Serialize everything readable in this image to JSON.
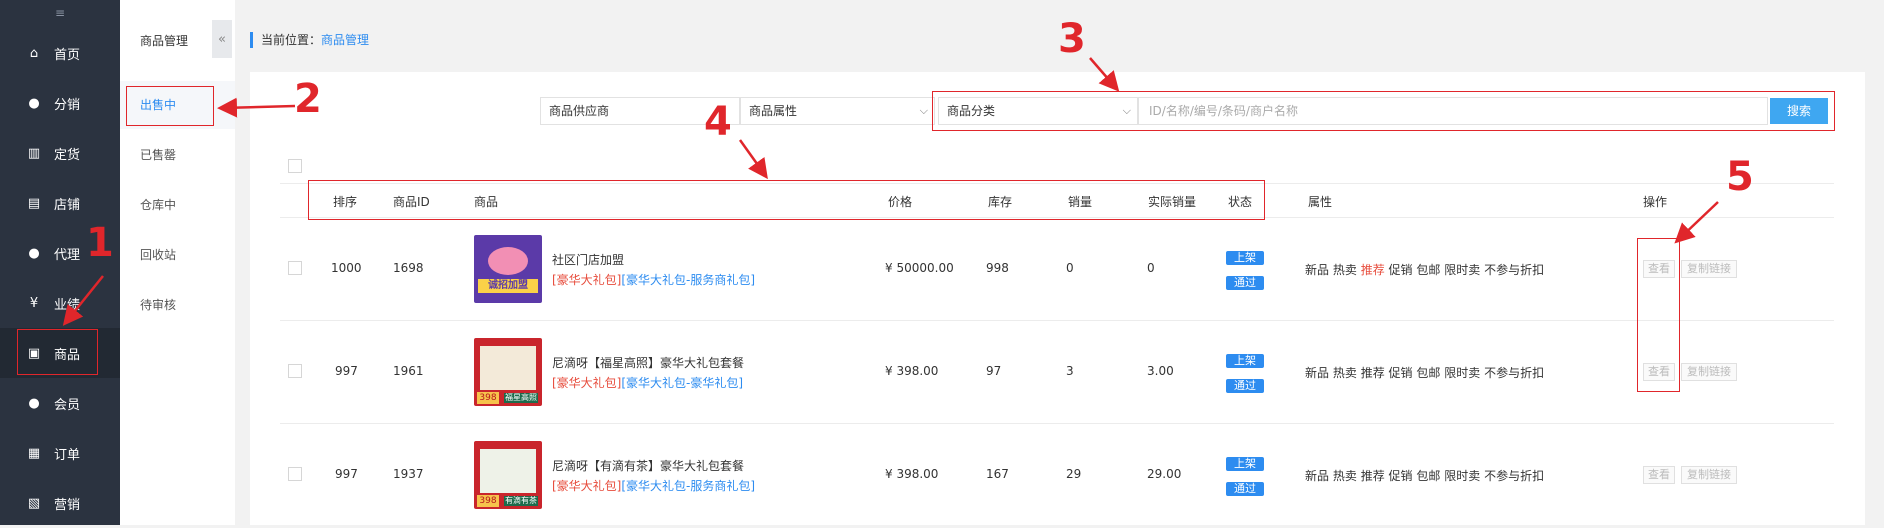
{
  "sidebar": {
    "items": [
      {
        "label": "首页",
        "icon": "home-icon",
        "glyph": "⌂"
      },
      {
        "label": "分销",
        "icon": "user-icon",
        "glyph": "●"
      },
      {
        "label": "定货",
        "icon": "bar-chart-icon",
        "glyph": "▥"
      },
      {
        "label": "店铺",
        "icon": "store-icon",
        "glyph": "▤"
      },
      {
        "label": "代理",
        "icon": "user-icon",
        "glyph": "●"
      },
      {
        "label": "业绩",
        "icon": "yen-icon",
        "glyph": "¥"
      },
      {
        "label": "商品",
        "icon": "goods-icon",
        "glyph": "▣"
      },
      {
        "label": "会员",
        "icon": "user-icon",
        "glyph": "●"
      },
      {
        "label": "订单",
        "icon": "document-icon",
        "glyph": "▦"
      },
      {
        "label": "营销",
        "icon": "gift-icon",
        "glyph": "▧"
      }
    ]
  },
  "submenu": {
    "title": "商品管理",
    "items": [
      "出售中",
      "已售罄",
      "仓库中",
      "回收站",
      "待审核"
    ]
  },
  "breadcrumb": {
    "prefix": "当前位置：",
    "current": "商品管理"
  },
  "filters": {
    "supplier": "商品供应商",
    "attribute": "商品属性",
    "category": "商品分类",
    "search_placeholder": "ID/名称/编号/条码/商户名称",
    "search_button": "搜索"
  },
  "table": {
    "headers": {
      "sort": "排序",
      "id": "商品ID",
      "product": "商品",
      "price": "价格",
      "stock": "库存",
      "sales": "销量",
      "actual_sales": "实际销量",
      "status": "状态",
      "attrs": "属性",
      "ops": "操作"
    },
    "rows": [
      {
        "sort": "1000",
        "id": "1698",
        "name": "社区门店加盟",
        "tag1": "[豪华大礼包]",
        "tag2": "[豪华大礼包-服务商礼包]",
        "price": "¥ 50000.00",
        "stock": "998",
        "sales": "0",
        "actual_sales": "0"
      },
      {
        "sort": "997",
        "id": "1961",
        "name": "尼滴呀【福星高照】豪华大礼包套餐",
        "tag1": "[豪华大礼包]",
        "tag2": "[豪华大礼包-豪华礼包]",
        "price": "¥ 398.00",
        "stock": "97",
        "sales": "3",
        "actual_sales": "3.00"
      },
      {
        "sort": "997",
        "id": "1937",
        "name": "尼滴呀【有滴有茶】豪华大礼包套餐",
        "tag1": "[豪华大礼包]",
        "tag2": "[豪华大礼包-服务商礼包]",
        "price": "¥ 398.00",
        "stock": "167",
        "sales": "29",
        "actual_sales": "29.00"
      }
    ],
    "status_labels": {
      "on_shelf": "上架",
      "approved": "通过"
    },
    "attr_labels": {
      "a1": "新品",
      "a2": "热卖",
      "a3": "推荐",
      "a4": "促销",
      "a5": "包邮",
      "a6": "限时卖",
      "a7": "不参与折扣"
    },
    "op_labels": {
      "view": "查看",
      "copy_link": "复制链接"
    },
    "thumb_text": {
      "t1": "诚招加盟",
      "t2": "398",
      "t3": "福星高照",
      "t4": "有滴有茶"
    }
  },
  "annotations": [
    "1",
    "2",
    "3",
    "4",
    "5"
  ],
  "colors": {
    "sidebar": "#2b3340",
    "accent": "#2d8cf0",
    "annotation": "#e0262b",
    "search_button": "#3fa7f1"
  }
}
